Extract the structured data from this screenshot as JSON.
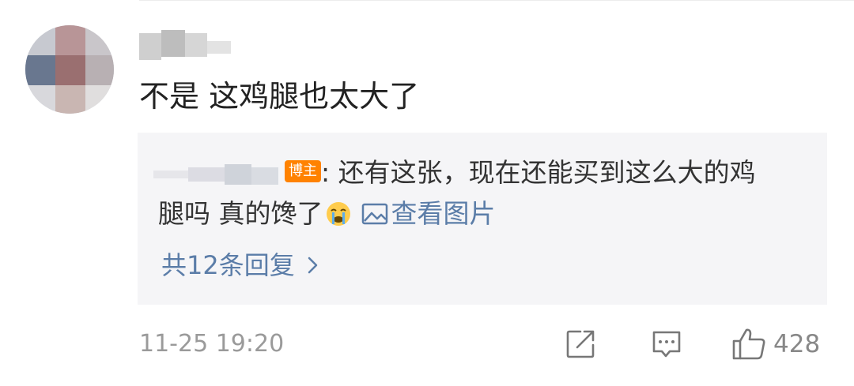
{
  "comment": {
    "text": "不是 这鸡腿也太大了",
    "timestamp": "11-25 19:20",
    "like_count": "428"
  },
  "reply_preview": {
    "badge": "博主",
    "line1": ": 还有这张，现在还能买到这么大的鸡",
    "line2": "腿吗 真的馋了",
    "emoji": "crying-face",
    "image_link_label": "查看图片",
    "reply_count_label": "共12条回复"
  },
  "icons": {
    "share": "share-icon",
    "comment": "comment-icon",
    "like": "thumbs-up-icon",
    "image": "image-icon",
    "chevron": "chevron-right-icon"
  },
  "colors": {
    "link": "#5b7da8",
    "badge": "#ff8200",
    "reply_background": "#f5f5f7",
    "text": "#222222",
    "muted": "#9a9a9a"
  }
}
